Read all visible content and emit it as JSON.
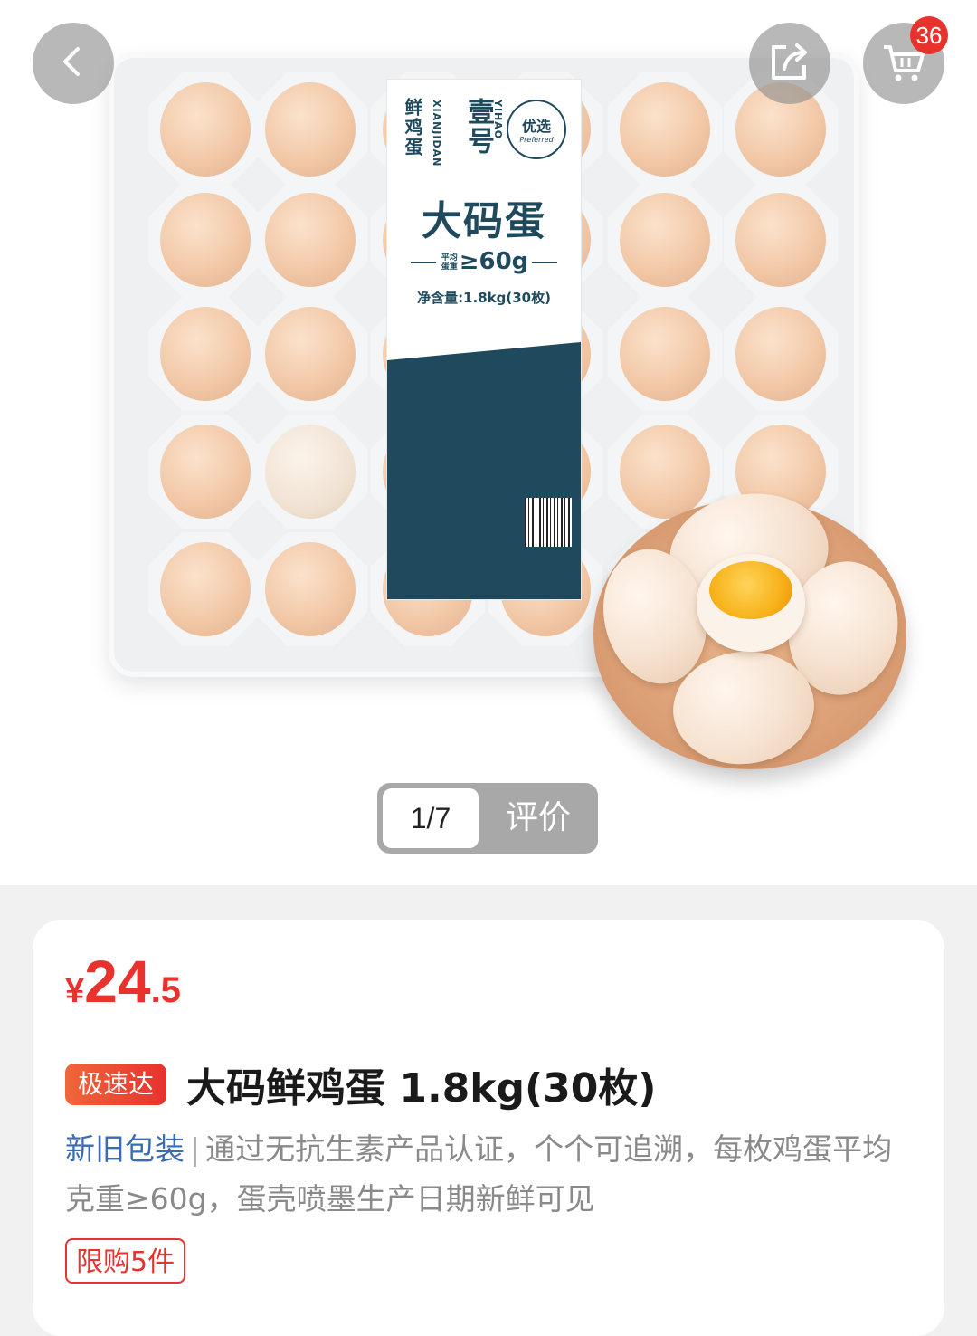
{
  "header": {
    "back_icon": "chevron-left-icon",
    "share_icon": "share-icon",
    "cart_icon": "cart-icon",
    "cart_count": "36"
  },
  "product_image": {
    "label": {
      "brand_cn": "壹号",
      "brand_en": "YIHAO",
      "sub_cn": "鲜鸡蛋",
      "sub_en": "XIANJIDAN",
      "seal_cn": "优选",
      "seal_en": "Preferred",
      "title": "大码蛋",
      "weight_note": "平均蛋重",
      "weight": "≥60g",
      "net": "净含量:1.8kg(30枚)"
    }
  },
  "pager": {
    "count": "1/7",
    "review_label": "评价"
  },
  "product": {
    "price_symbol": "¥",
    "price_int": "24",
    "price_dec": ".5",
    "tag": "极速达",
    "title": "大码鲜鸡蛋 1.8kg(30枚)",
    "package_note": "新旧包装",
    "separator": "|",
    "description": "通过无抗生素产品认证，个个可追溯，每枚鸡蛋平均克重≥60g，蛋壳喷墨生产日期新鲜可见",
    "limit": "限购5件"
  },
  "colors": {
    "accent_red": "#e8322e",
    "label_blue": "#1f4a5e",
    "link_blue": "#3a6bb5"
  }
}
